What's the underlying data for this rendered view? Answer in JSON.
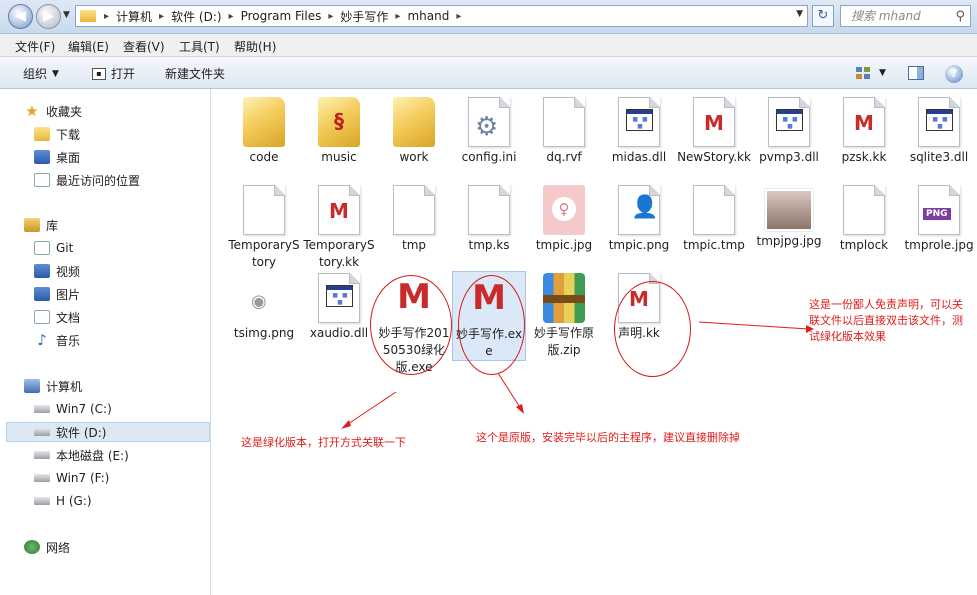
{
  "address": {
    "crumbs": [
      "计算机",
      "软件 (D:)",
      "Program Files",
      "妙手写作",
      "mhand"
    ],
    "search_placeholder": "搜索 mhand"
  },
  "menu": [
    "文件(F)",
    "编辑(E)",
    "查看(V)",
    "工具(T)",
    "帮助(H)"
  ],
  "toolbar": {
    "organize": "组织",
    "open": "打开",
    "new_folder": "新建文件夹"
  },
  "nav": {
    "favorites": {
      "title": "收藏夹",
      "items": [
        "下载",
        "桌面",
        "最近访问的位置"
      ]
    },
    "libraries": {
      "title": "库",
      "items": [
        "Git",
        "视频",
        "图片",
        "文档",
        "音乐"
      ]
    },
    "computer": {
      "title": "计算机",
      "items": [
        "Win7 (C:)",
        "软件 (D:)",
        "本地磁盘 (E:)",
        "Win7 (F:)",
        "H (G:)"
      ]
    },
    "network": "网络"
  },
  "files": [
    {
      "name": "code",
      "icon": "folder-icon"
    },
    {
      "name": "music",
      "icon": "folder-icon"
    },
    {
      "name": "work",
      "icon": "folder-icon"
    },
    {
      "name": "config.ini",
      "icon": "settings-file-icon"
    },
    {
      "name": "dq.rvf",
      "icon": "blank-file-icon"
    },
    {
      "name": "midas.dll",
      "icon": "dll-icon"
    },
    {
      "name": "NewStory.kk",
      "icon": "m-logo-file-icon"
    },
    {
      "name": "pvmp3.dll",
      "icon": "dll-icon"
    },
    {
      "name": "pzsk.kk",
      "icon": "m-logo-file-icon"
    },
    {
      "name": "sqlite3.dll",
      "icon": "dll-icon"
    },
    {
      "name": "TemporaryStory",
      "icon": "blank-file-icon"
    },
    {
      "name": "TemporaryStory.kk",
      "icon": "m-logo-file-icon"
    },
    {
      "name": "tmp",
      "icon": "blank-file-icon"
    },
    {
      "name": "tmp.ks",
      "icon": "blank-file-icon"
    },
    {
      "name": "tmpic.jpg",
      "icon": "female-avatar-icon"
    },
    {
      "name": "tmpic.png",
      "icon": "person-icon"
    },
    {
      "name": "tmpic.tmp",
      "icon": "blank-file-icon"
    },
    {
      "name": "tmpjpg.jpg",
      "icon": "photo-icon"
    },
    {
      "name": "tmplock",
      "icon": "blank-file-icon"
    },
    {
      "name": "tmprole.jpg",
      "icon": "png-file-icon"
    },
    {
      "name": "tsimg.png",
      "icon": "image-file-icon"
    },
    {
      "name": "xaudio.dll",
      "icon": "dll-icon"
    },
    {
      "name": "妙手写作20150530绿化版.exe",
      "icon": "m-logo-app-icon"
    },
    {
      "name": "妙手写作.exe",
      "icon": "m-logo-app-icon"
    },
    {
      "name": "妙手写作原版.zip",
      "icon": "zip-archive-icon"
    },
    {
      "name": "声明.kk",
      "icon": "m-logo-file-icon"
    }
  ],
  "annotations": {
    "green": "这是绿化版本，打开方式关联一下",
    "original": "这个是原版，安装完毕以后的主程序，建议直接删除掉",
    "statement_1": "这是一份鄙人免责声明，可以关",
    "statement_2": "联文件以后直接双击该文件，测",
    "statement_3": "试绿化版本效果"
  },
  "colors": {
    "annotation": "#e01b1b",
    "selection": "#dbe8f8"
  }
}
